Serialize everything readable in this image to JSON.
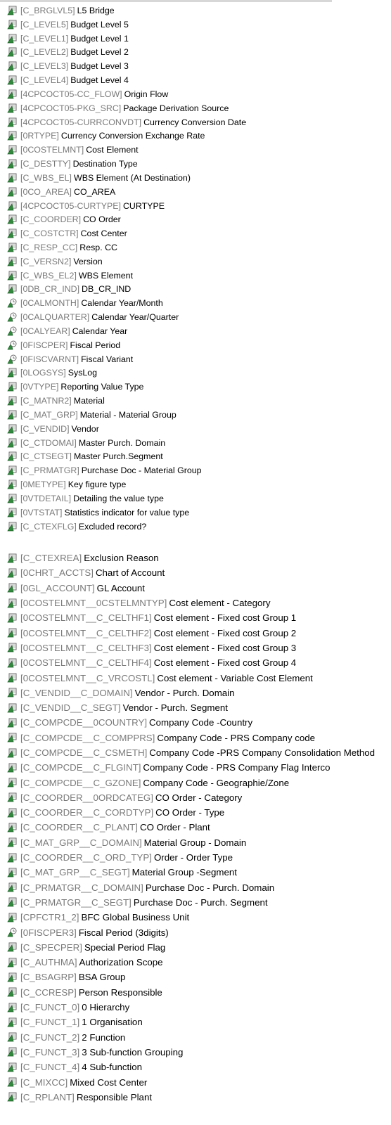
{
  "colors": {
    "icon_green": "#2e8b3a",
    "icon_dark": "#1f5e28",
    "tech_gray": "#7a7a7a"
  },
  "list1": [
    {
      "icon": "characteristic-icon",
      "tech": "[C_BRGLVL5]",
      "desc": "L5 Bridge"
    },
    {
      "icon": "characteristic-icon",
      "tech": "[C_LEVEL5]",
      "desc": "Budget Level 5"
    },
    {
      "icon": "characteristic-icon",
      "tech": "[C_LEVEL1]",
      "desc": "Budget Level 1"
    },
    {
      "icon": "characteristic-icon",
      "tech": "[C_LEVEL2]",
      "desc": "Budget Level 2"
    },
    {
      "icon": "characteristic-icon",
      "tech": "[C_LEVEL3]",
      "desc": "Budget Level 3"
    },
    {
      "icon": "characteristic-icon",
      "tech": "[C_LEVEL4]",
      "desc": "Budget Level 4"
    },
    {
      "icon": "characteristic-icon",
      "tech": "[4CPCOCT05-CC_FLOW]",
      "desc": "Origin Flow"
    },
    {
      "icon": "characteristic-icon",
      "tech": "[4CPCOCT05-PKG_SRC]",
      "desc": "Package Derivation Source"
    },
    {
      "icon": "characteristic-icon",
      "tech": "[4CPCOCT05-CURRCONVDT]",
      "desc": "Currency Conversion Date"
    },
    {
      "icon": "characteristic-icon",
      "tech": "[0RTYPE]",
      "desc": "Currency Conversion Exchange Rate"
    },
    {
      "icon": "characteristic-icon",
      "tech": "[0COSTELMNT]",
      "desc": "Cost Element"
    },
    {
      "icon": "characteristic-icon",
      "tech": "[C_DESTTY]",
      "desc": "Destination Type"
    },
    {
      "icon": "characteristic-icon",
      "tech": "[C_WBS_EL]",
      "desc": "WBS Element (At Destination)"
    },
    {
      "icon": "characteristic-icon",
      "tech": "[0CO_AREA]",
      "desc": "CO_AREA"
    },
    {
      "icon": "characteristic-icon",
      "tech": "[4CPCOCT05-CURTYPE]",
      "desc": "CURTYPE"
    },
    {
      "icon": "characteristic-icon",
      "tech": "[C_COORDER]",
      "desc": "CO Order"
    },
    {
      "icon": "characteristic-icon",
      "tech": "[C_COSTCTR]",
      "desc": "Cost Center"
    },
    {
      "icon": "characteristic-icon",
      "tech": "[C_RESP_CC]",
      "desc": "Resp. CC"
    },
    {
      "icon": "characteristic-icon",
      "tech": "[C_VERSN2]",
      "desc": "Version"
    },
    {
      "icon": "characteristic-icon",
      "tech": "[C_WBS_EL2]",
      "desc": "WBS Element"
    },
    {
      "icon": "characteristic-icon",
      "tech": "[0DB_CR_IND]",
      "desc": "DB_CR_IND"
    },
    {
      "icon": "time-characteristic-icon",
      "tech": "[0CALMONTH]",
      "desc": "Calendar Year/Month"
    },
    {
      "icon": "time-characteristic-icon",
      "tech": "[0CALQUARTER]",
      "desc": "Calendar Year/Quarter"
    },
    {
      "icon": "time-characteristic-icon",
      "tech": "[0CALYEAR]",
      "desc": "Calendar Year"
    },
    {
      "icon": "time-characteristic-icon",
      "tech": "[0FISCPER]",
      "desc": "Fiscal Period"
    },
    {
      "icon": "time-characteristic-icon",
      "tech": "[0FISCVARNT]",
      "desc": "Fiscal Variant"
    },
    {
      "icon": "characteristic-icon",
      "tech": "[0LOGSYS]",
      "desc": "SysLog"
    },
    {
      "icon": "characteristic-icon",
      "tech": "[0VTYPE]",
      "desc": "Reporting Value Type"
    },
    {
      "icon": "characteristic-icon",
      "tech": "[C_MATNR2]",
      "desc": "Material"
    },
    {
      "icon": "characteristic-icon",
      "tech": "[C_MAT_GRP]",
      "desc": "Material - Material Group"
    },
    {
      "icon": "characteristic-icon",
      "tech": "[C_VENDID]",
      "desc": "Vendor"
    },
    {
      "icon": "characteristic-icon",
      "tech": "[C_CTDOMAI]",
      "desc": "Master Purch. Domain"
    },
    {
      "icon": "characteristic-icon",
      "tech": "[C_CTSEGT]",
      "desc": "Master Purch.Segment"
    },
    {
      "icon": "characteristic-icon",
      "tech": "[C_PRMATGR]",
      "desc": "Purchase Doc - Material Group"
    },
    {
      "icon": "characteristic-icon",
      "tech": "[0METYPE]",
      "desc": "Key figure type"
    },
    {
      "icon": "characteristic-icon",
      "tech": "[0VTDETAIL]",
      "desc": "Detailing the value type"
    },
    {
      "icon": "characteristic-icon",
      "tech": "[0VTSTAT]",
      "desc": "Statistics indicator for value type"
    },
    {
      "icon": "characteristic-icon",
      "tech": "[C_CTEXFLG]",
      "desc": "Excluded record?"
    }
  ],
  "list2": [
    {
      "icon": "characteristic-icon",
      "tech": "[C_CTEXREA]",
      "desc": "Exclusion Reason"
    },
    {
      "icon": "characteristic-icon",
      "tech": "[0CHRT_ACCTS]",
      "desc": "Chart of Account"
    },
    {
      "icon": "characteristic-icon",
      "tech": "[0GL_ACCOUNT]",
      "desc": "GL Account"
    },
    {
      "icon": "characteristic-icon",
      "tech": "[0COSTELMNT__0CSTELMNTYP]",
      "desc": "Cost element - Category"
    },
    {
      "icon": "characteristic-icon",
      "tech": "[0COSTELMNT__C_CELTHF1]",
      "desc": "Cost element - Fixed cost Group 1"
    },
    {
      "icon": "characteristic-icon",
      "tech": "[0COSTELMNT__C_CELTHF2]",
      "desc": "Cost element - Fixed cost Group 2"
    },
    {
      "icon": "characteristic-icon",
      "tech": "[0COSTELMNT__C_CELTHF3]",
      "desc": "Cost element - Fixed cost Group 3"
    },
    {
      "icon": "characteristic-icon",
      "tech": "[0COSTELMNT__C_CELTHF4]",
      "desc": "Cost element - Fixed cost Group 4"
    },
    {
      "icon": "characteristic-icon",
      "tech": "[0COSTELMNT__C_VRCOSTL]",
      "desc": "Cost element - Variable Cost Element"
    },
    {
      "icon": "characteristic-icon",
      "tech": "[C_VENDID__C_DOMAIN]",
      "desc": "Vendor - Purch. Domain"
    },
    {
      "icon": "characteristic-icon",
      "tech": "[C_VENDID__C_SEGT]",
      "desc": "Vendor - Purch. Segment"
    },
    {
      "icon": "characteristic-icon",
      "tech": "[C_COMPCDE__0COUNTRY]",
      "desc": "Company Code -Country"
    },
    {
      "icon": "characteristic-icon",
      "tech": "[C_COMPCDE__C_COMPPRS]",
      "desc": "Company Code - PRS Company code"
    },
    {
      "icon": "characteristic-icon",
      "tech": "[C_COMPCDE__C_CSMETH]",
      "desc": "Company Code -PRS Company Consolidation Method"
    },
    {
      "icon": "characteristic-icon",
      "tech": "[C_COMPCDE__C_FLGINT]",
      "desc": "Company Code - PRS Company Flag Interco"
    },
    {
      "icon": "characteristic-icon",
      "tech": "[C_COMPCDE__C_GZONE]",
      "desc": "Company Code - Geographie/Zone"
    },
    {
      "icon": "characteristic-icon",
      "tech": "[C_COORDER__0ORDCATEG]",
      "desc": "CO Order - Category"
    },
    {
      "icon": "characteristic-icon",
      "tech": "[C_COORDER__C_CORDTYP]",
      "desc": "CO Order - Type"
    },
    {
      "icon": "characteristic-icon",
      "tech": "[C_COORDER__C_PLANT]",
      "desc": "CO Order - Plant"
    },
    {
      "icon": "characteristic-icon",
      "tech": "[C_MAT_GRP__C_DOMAIN]",
      "desc": "Material Group - Domain"
    },
    {
      "icon": "characteristic-icon",
      "tech": "[C_COORDER__C_ORD_TYP]",
      "desc": "Order - Order Type"
    },
    {
      "icon": "characteristic-icon",
      "tech": "[C_MAT_GRP__C_SEGT]",
      "desc": "Material Group -Segment"
    },
    {
      "icon": "characteristic-icon",
      "tech": "[C_PRMATGR__C_DOMAIN]",
      "desc": "Purchase Doc - Purch. Domain"
    },
    {
      "icon": "characteristic-icon",
      "tech": "[C_PRMATGR__C_SEGT]",
      "desc": "Purchase Doc - Purch. Segment"
    },
    {
      "icon": "characteristic-icon",
      "tech": "[CPFCTR1_2]",
      "desc": "BFC Global Business Unit"
    },
    {
      "icon": "time-characteristic-icon",
      "tech": "[0FISCPER3]",
      "desc": "Fiscal Period (3digits)"
    },
    {
      "icon": "characteristic-icon",
      "tech": "[C_SPECPER]",
      "desc": "Special Period Flag"
    },
    {
      "icon": "characteristic-icon",
      "tech": "[C_AUTHMA]",
      "desc": "Authorization Scope"
    },
    {
      "icon": "characteristic-icon",
      "tech": "[C_BSAGRP]",
      "desc": "BSA Group"
    },
    {
      "icon": "characteristic-icon",
      "tech": "[C_CCRESP]",
      "desc": "Person Responsible"
    },
    {
      "icon": "characteristic-icon",
      "tech": "[C_FUNCT_0]",
      "desc": "0 Hierarchy"
    },
    {
      "icon": "characteristic-icon",
      "tech": "[C_FUNCT_1]",
      "desc": "1 Organisation"
    },
    {
      "icon": "characteristic-icon",
      "tech": "[C_FUNCT_2]",
      "desc": "2 Function"
    },
    {
      "icon": "characteristic-icon",
      "tech": "[C_FUNCT_3]",
      "desc": "3 Sub-function Grouping"
    },
    {
      "icon": "characteristic-icon",
      "tech": "[C_FUNCT_4]",
      "desc": "4 Sub-function"
    },
    {
      "icon": "characteristic-icon",
      "tech": "[C_MIXCC]",
      "desc": "Mixed Cost Center"
    },
    {
      "icon": "characteristic-icon",
      "tech": "[C_RPLANT]",
      "desc": "Responsible Plant"
    }
  ]
}
